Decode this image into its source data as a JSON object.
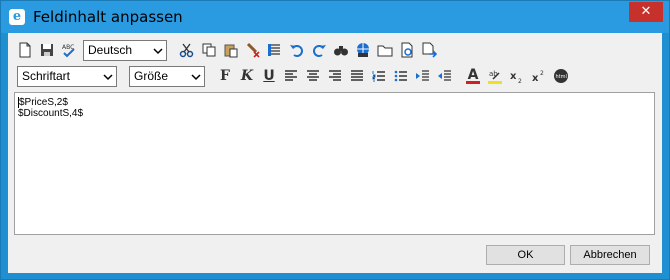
{
  "window": {
    "title": "Feldinhalt anpassen",
    "close_glyph": "✕"
  },
  "toolbar": {
    "language_select": "Deutsch",
    "font_select": "Schriftart",
    "size_select": "Größe",
    "row1_icons": [
      "new-document-icon",
      "save-icon",
      "spellcheck-icon",
      "cut-icon",
      "copy-icon",
      "paste-icon",
      "clear-format-icon",
      "paragraph-icon",
      "undo-icon",
      "redo-icon",
      "find-icon",
      "insert-link-icon",
      "open-folder-icon",
      "preview-icon",
      "export-icon"
    ],
    "row2_icons": [
      "bold-icon",
      "italic-icon",
      "underline-icon",
      "align-left-icon",
      "align-center-icon",
      "align-right-icon",
      "justify-icon",
      "numbered-list-icon",
      "bullet-list-icon",
      "indent-icon",
      "outdent-icon",
      "font-color-icon",
      "highlight-icon",
      "subscript-icon",
      "superscript-icon",
      "html-icon"
    ],
    "bold_glyph": "F",
    "italic_glyph": "K",
    "underline_glyph": "U",
    "font_color_glyph": "A"
  },
  "editor": {
    "lines": [
      "$PriceS,2$",
      "$DiscountS,4$"
    ]
  },
  "buttons": {
    "ok": "OK",
    "cancel": "Abbrechen"
  },
  "colors": {
    "titlebar": "#2a9be0",
    "close": "#c7312c",
    "icon_blue": "#1a4d8f"
  }
}
